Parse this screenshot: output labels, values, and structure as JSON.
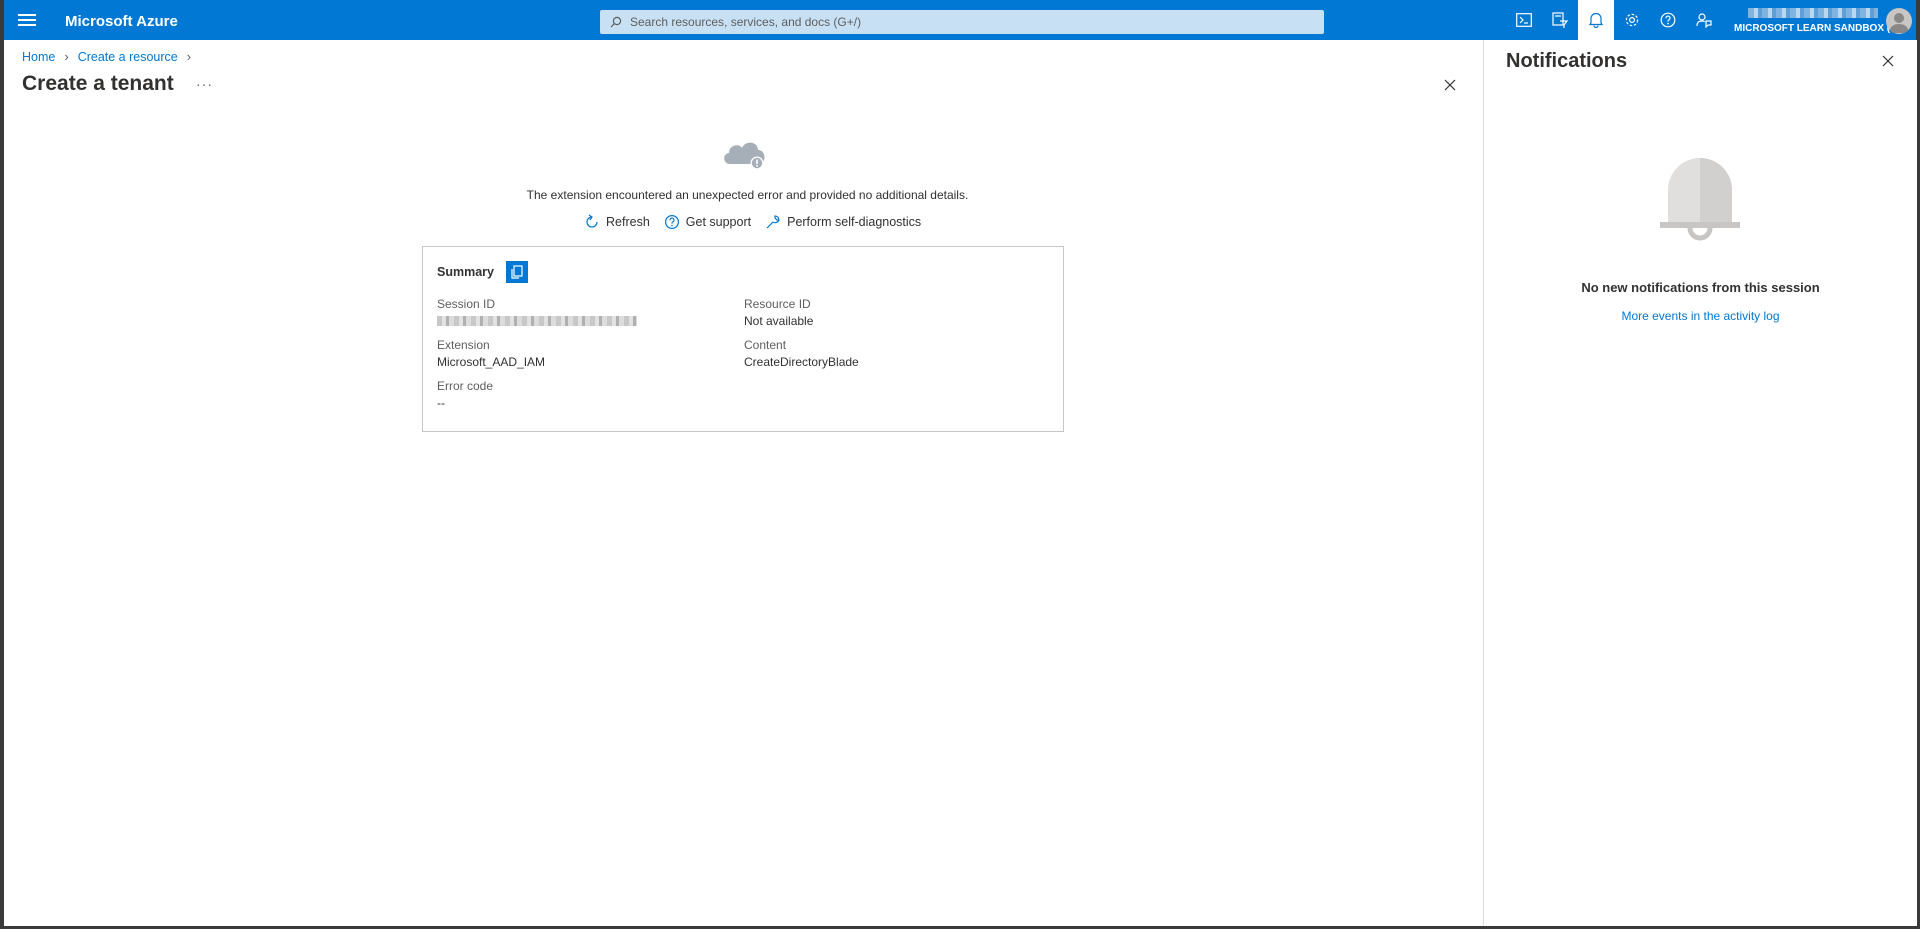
{
  "topbar": {
    "brand": "Microsoft Azure",
    "search_placeholder": "Search resources, services, and docs (G+/)",
    "icons": [
      "cloud-shell-icon",
      "directory-filter-icon",
      "notifications-icon",
      "settings-icon",
      "help-icon",
      "feedback-icon"
    ],
    "active_icon": "notifications-icon",
    "account": {
      "directory": "MICROSOFT LEARN SANDBOX (L..."
    },
    "accent_color": "#0078d4"
  },
  "breadcrumb": {
    "items": [
      "Home",
      "Create a resource"
    ]
  },
  "blade": {
    "title": "Create a tenant",
    "more_label": "···",
    "error_message": "The extension encountered an unexpected error and provided no additional details.",
    "actions": {
      "refresh": "Refresh",
      "support": "Get support",
      "diagnostics": "Perform self-diagnostics"
    },
    "summary": {
      "title": "Summary",
      "session_id_label": "Session ID",
      "resource_id_label": "Resource ID",
      "resource_id_value": "Not available",
      "extension_label": "Extension",
      "extension_value": "Microsoft_AAD_IAM",
      "content_label": "Content",
      "content_value": "CreateDirectoryBlade",
      "error_code_label": "Error code",
      "error_code_value": "--"
    }
  },
  "notifications": {
    "title": "Notifications",
    "empty_message": "No new notifications from this session",
    "activity_link": "More events in the activity log"
  }
}
